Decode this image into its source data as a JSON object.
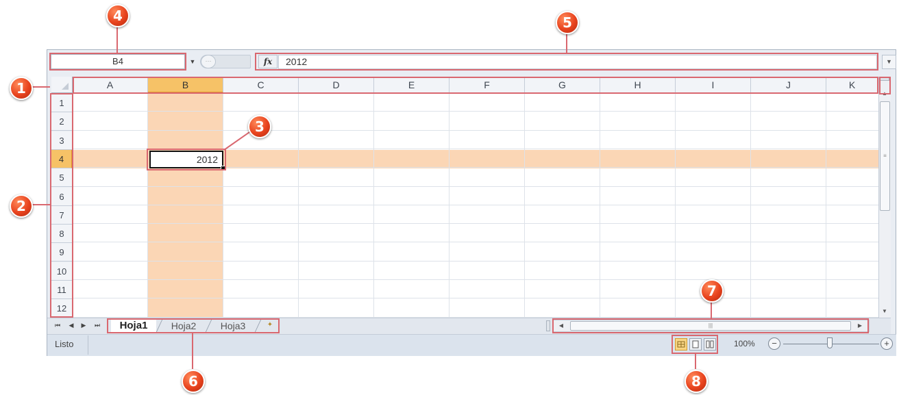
{
  "formula_bar": {
    "name_box": "B4",
    "fx_label": "fx",
    "formula_value": "2012"
  },
  "columns": [
    "A",
    "B",
    "C",
    "D",
    "E",
    "F",
    "G",
    "H",
    "I",
    "J",
    "K"
  ],
  "rows": [
    "1",
    "2",
    "3",
    "4",
    "5",
    "6",
    "7",
    "8",
    "9",
    "10",
    "11",
    "12"
  ],
  "selected_column": "B",
  "selected_row": "4",
  "active_cell": {
    "ref": "B4",
    "value": "2012"
  },
  "sheet_tabs": {
    "tabs": [
      {
        "label": "Hoja1",
        "active": true
      },
      {
        "label": "Hoja2",
        "active": false
      },
      {
        "label": "Hoja3",
        "active": false
      }
    ],
    "nav_first": "⏮",
    "nav_prev": "◀",
    "nav_next": "▶",
    "nav_last": "⏭"
  },
  "status_bar": {
    "status": "Listo",
    "zoom": "100%",
    "zoom_minus": "−",
    "zoom_plus": "+"
  },
  "annotations": [
    "1",
    "2",
    "3",
    "4",
    "5",
    "6",
    "7",
    "8"
  ],
  "colors": {
    "selection_highlight": "#fbd6b5",
    "header_selected": "#f6c267",
    "annotation": "#d9676f",
    "badge": "#e8431e"
  }
}
